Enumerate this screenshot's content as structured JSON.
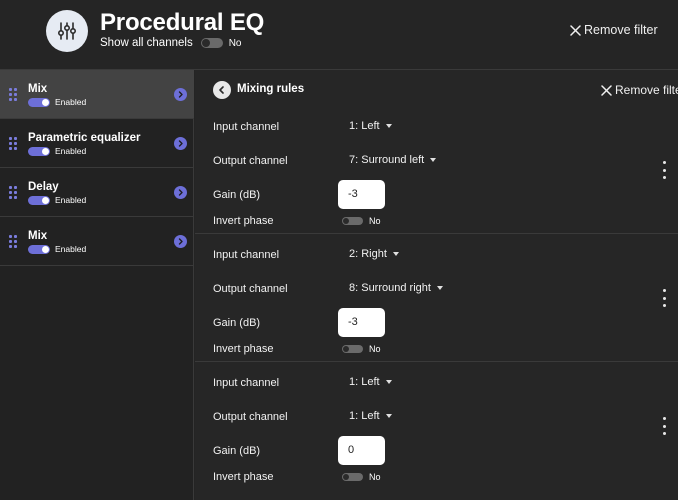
{
  "header": {
    "title": "Procedural EQ",
    "show_all_label": "Show all channels",
    "show_all_value": "No",
    "remove_label": "Remove filter"
  },
  "sidebar": {
    "items": [
      {
        "name": "Mix",
        "status": "Enabled"
      },
      {
        "name": "Parametric equalizer",
        "status": "Enabled"
      },
      {
        "name": "Delay",
        "status": "Enabled"
      },
      {
        "name": "Mix",
        "status": "Enabled"
      }
    ]
  },
  "panel": {
    "title": "Mixing rules",
    "remove_label": "Remove filter",
    "labels": {
      "input": "Input channel",
      "output": "Output channel",
      "gain": "Gain (dB)",
      "invert": "Invert phase"
    },
    "rules": [
      {
        "input": "1: Left",
        "output": "7: Surround left",
        "gain": "-3",
        "invert": "No"
      },
      {
        "input": "2: Right",
        "output": "8: Surround right",
        "gain": "-3",
        "invert": "No"
      },
      {
        "input": "1: Left",
        "output": "1: Left",
        "gain": "0",
        "invert": "No"
      }
    ]
  },
  "icons": {
    "app": "equalizer-sliders-icon",
    "back": "chevron-left-icon",
    "item_chevron": "chevron-right-icon",
    "remove": "close-icon",
    "more": "more-vertical-icon",
    "drag": "drag-handle-icon"
  },
  "colors": {
    "accent": "#6d6fd8",
    "background": "#242424",
    "active_item": "#434343"
  }
}
